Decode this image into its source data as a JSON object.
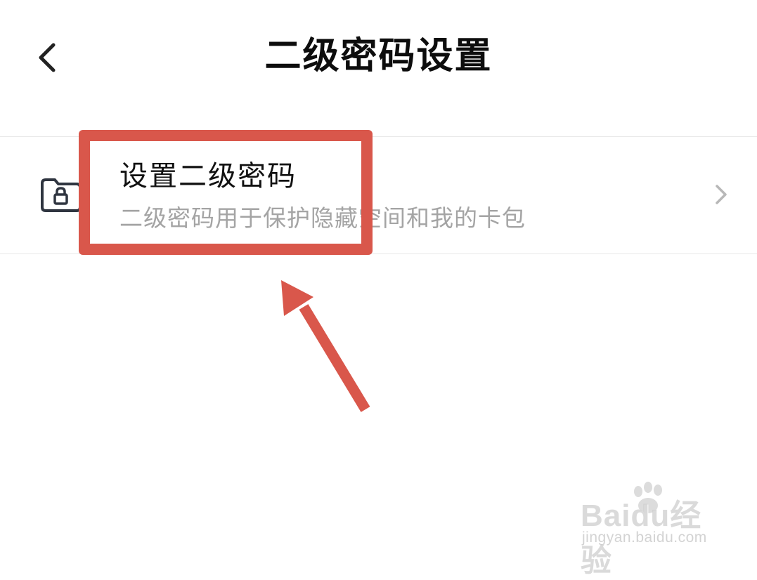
{
  "header": {
    "title": "二级密码设置",
    "back_icon": "chevron-left-icon"
  },
  "setting": {
    "title": "设置二级密码",
    "description": "二级密码用于保护隐藏空间和我的卡包",
    "leading_icon": "folder-lock-icon",
    "trailing_icon": "chevron-right-icon"
  },
  "annotation": {
    "highlight_color": "#d9574b",
    "arrow_color": "#d9574b"
  },
  "watermark": {
    "logo_text": "Baidu经验",
    "url": "jingyan.baidu.com"
  }
}
